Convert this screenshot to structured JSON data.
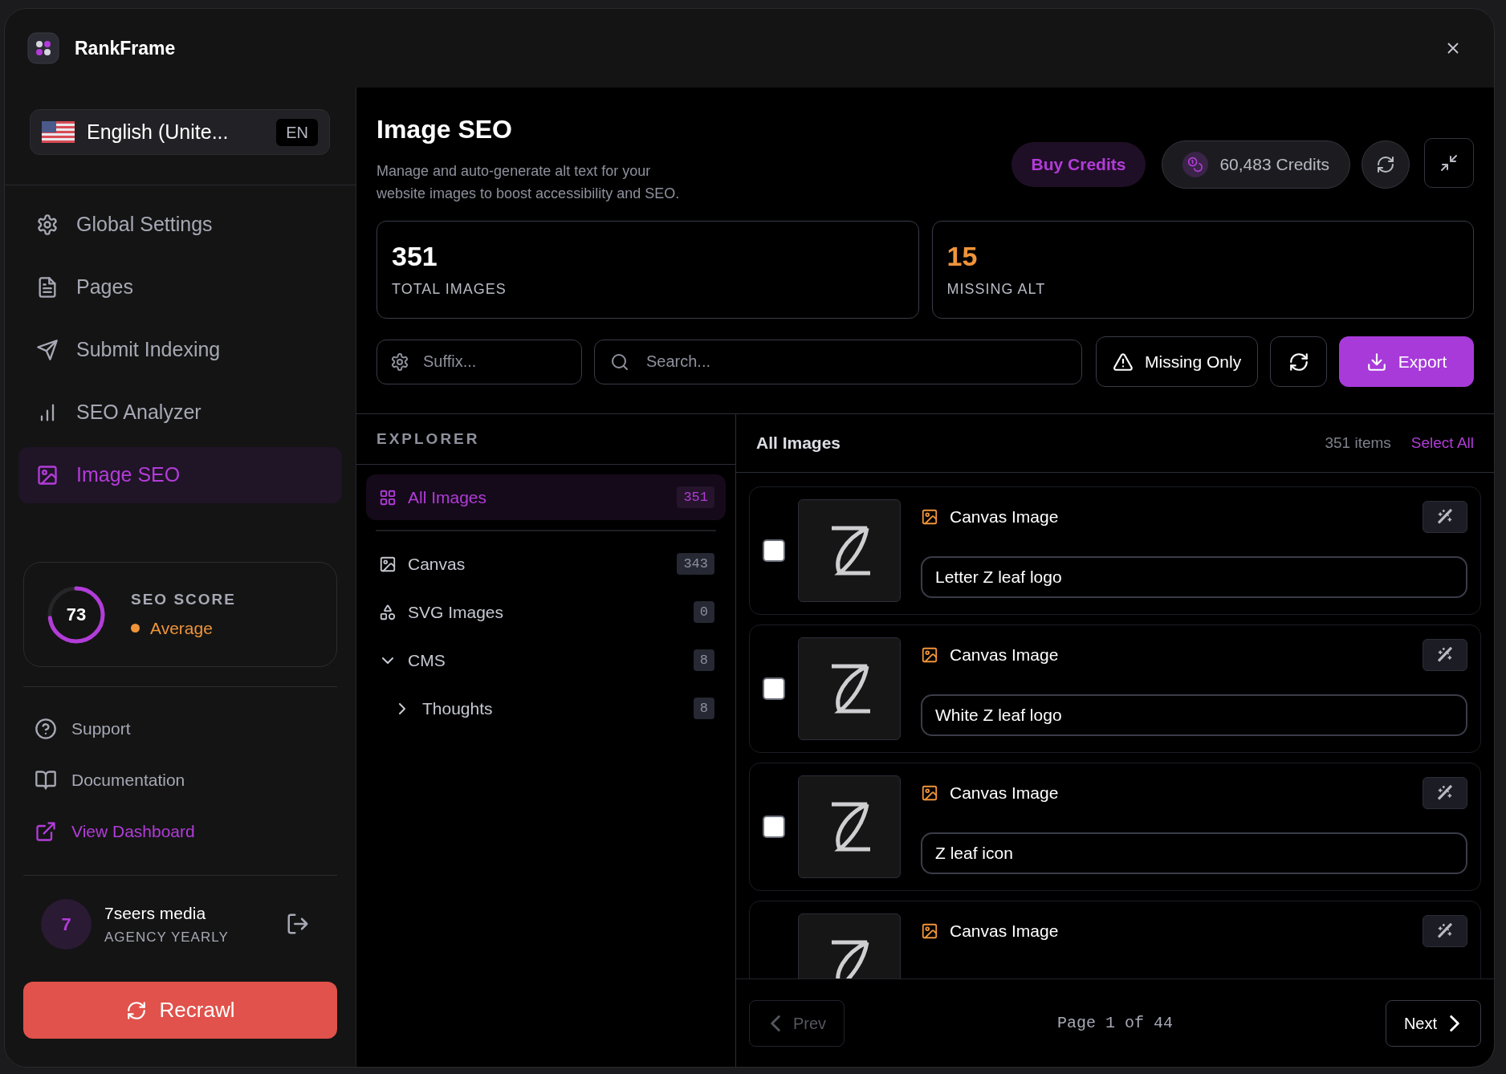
{
  "app": {
    "name": "RankFrame"
  },
  "language": {
    "label": "English (Unite...",
    "code": "EN"
  },
  "nav": [
    {
      "label": "Global Settings",
      "kind": "settings",
      "selected": false
    },
    {
      "label": "Pages",
      "kind": "pages",
      "selected": false
    },
    {
      "label": "Submit Indexing",
      "kind": "indexing",
      "selected": false
    },
    {
      "label": "SEO Analyzer",
      "kind": "analyzer",
      "selected": false
    },
    {
      "label": "Image SEO",
      "kind": "images",
      "selected": true
    }
  ],
  "seo_score": {
    "value": "73",
    "level": 0.73,
    "label": "SEO SCORE",
    "rating": "Average"
  },
  "links": [
    {
      "label": "Support",
      "kind": "help"
    },
    {
      "label": "Documentation",
      "kind": "docs"
    },
    {
      "label": "View Dashboard",
      "kind": "external"
    }
  ],
  "account": {
    "initial": "7",
    "name": "7seers media",
    "plan": "AGENCY YEARLY"
  },
  "recrawl_button": "Recrawl",
  "header": {
    "title": "Image SEO",
    "description": "Manage and auto-generate alt text for your website images to boost accessibility and SEO.",
    "buy_credits": "Buy Credits",
    "credits": "60,483 Credits"
  },
  "stats": [
    {
      "value": "351",
      "label": "TOTAL IMAGES",
      "kind": "total"
    },
    {
      "value": "15",
      "label": "MISSING ALT",
      "kind": "warning"
    }
  ],
  "toolbar": {
    "suffix_field": {
      "placeholder": "Suffix..."
    },
    "search_field": {
      "placeholder": "Search..."
    },
    "missing_only": "Missing Only",
    "export": "Export"
  },
  "explorer": {
    "title": "EXPLORER",
    "items": [
      {
        "label": "All Images",
        "count": "351",
        "kind": "all",
        "selected": true
      },
      {
        "label": "Canvas",
        "count": "343",
        "kind": "canvas",
        "selected": false
      },
      {
        "label": "SVG Images",
        "count": "0",
        "kind": "svg",
        "selected": false
      },
      {
        "label": "CMS",
        "count": "8",
        "kind": "folder",
        "selected": false,
        "expanded": true,
        "children": [
          {
            "label": "Thoughts",
            "count": "8",
            "kind": "folder",
            "selected": false,
            "expanded": false
          }
        ]
      }
    ]
  },
  "list": {
    "title": "All Images",
    "count": "351 items",
    "select_all": "Select All",
    "images": [
      {
        "type": "Canvas Image",
        "alt": "Letter Z leaf logo",
        "checked": false
      },
      {
        "type": "Canvas Image",
        "alt": "White Z leaf logo",
        "checked": false
      },
      {
        "type": "Canvas Image",
        "alt": "Z leaf icon",
        "checked": false
      },
      {
        "type": "Canvas Image"
      }
    ]
  },
  "pagination": {
    "prev": "Prev",
    "prev_disabled": true,
    "page": "Page 1 of 44",
    "next": "Next"
  }
}
